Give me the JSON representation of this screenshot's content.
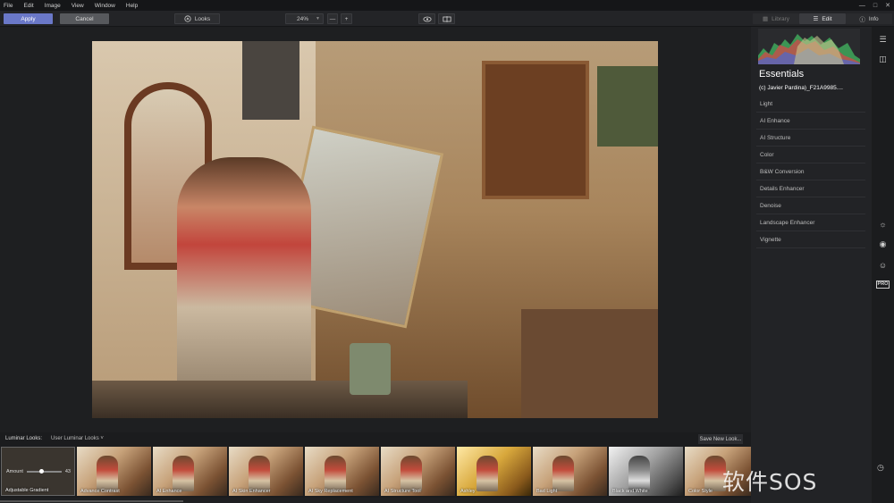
{
  "menu": [
    "File",
    "Edit",
    "Image",
    "View",
    "Window",
    "Help"
  ],
  "window_controls": [
    "—",
    "□",
    "✕"
  ],
  "toolbar": {
    "apply": "Apply",
    "cancel": "Cancel",
    "looks": "Looks",
    "zoom": "24%",
    "zoom_minus": "—",
    "zoom_plus": "+"
  },
  "tabs": {
    "library": "Library",
    "edit": "Edit",
    "info": "Info"
  },
  "panel": {
    "title": "Essentials",
    "file": "(c) Javier Pardina)_F21A9985....",
    "tools": [
      "Light",
      "AI Enhance",
      "AI Structure",
      "Color",
      "B&W Conversion",
      "Details Enhancer",
      "Denoise",
      "Landscape Enhancer",
      "Vignette"
    ],
    "pro": "PRO"
  },
  "strip": {
    "label": "Luminar Looks:",
    "collection": "User Luminar Looks",
    "save": "Save New Look...",
    "amount_label": "Amount",
    "amount_value": "43",
    "amount_fraction": 0.43,
    "looks": [
      "Adjustable Gradient",
      "Advance Contrast",
      "AI Enhance",
      "AI Skin Enhancer",
      "AI Sky Replacement",
      "AI Structure Tool",
      "Ashley",
      "Bad Light",
      "Black and White",
      "Color Style"
    ]
  },
  "watermark": "软件SOS",
  "colors": {
    "accent": "#6a78c8",
    "panel": "#222326",
    "background": "#1e1f21"
  }
}
